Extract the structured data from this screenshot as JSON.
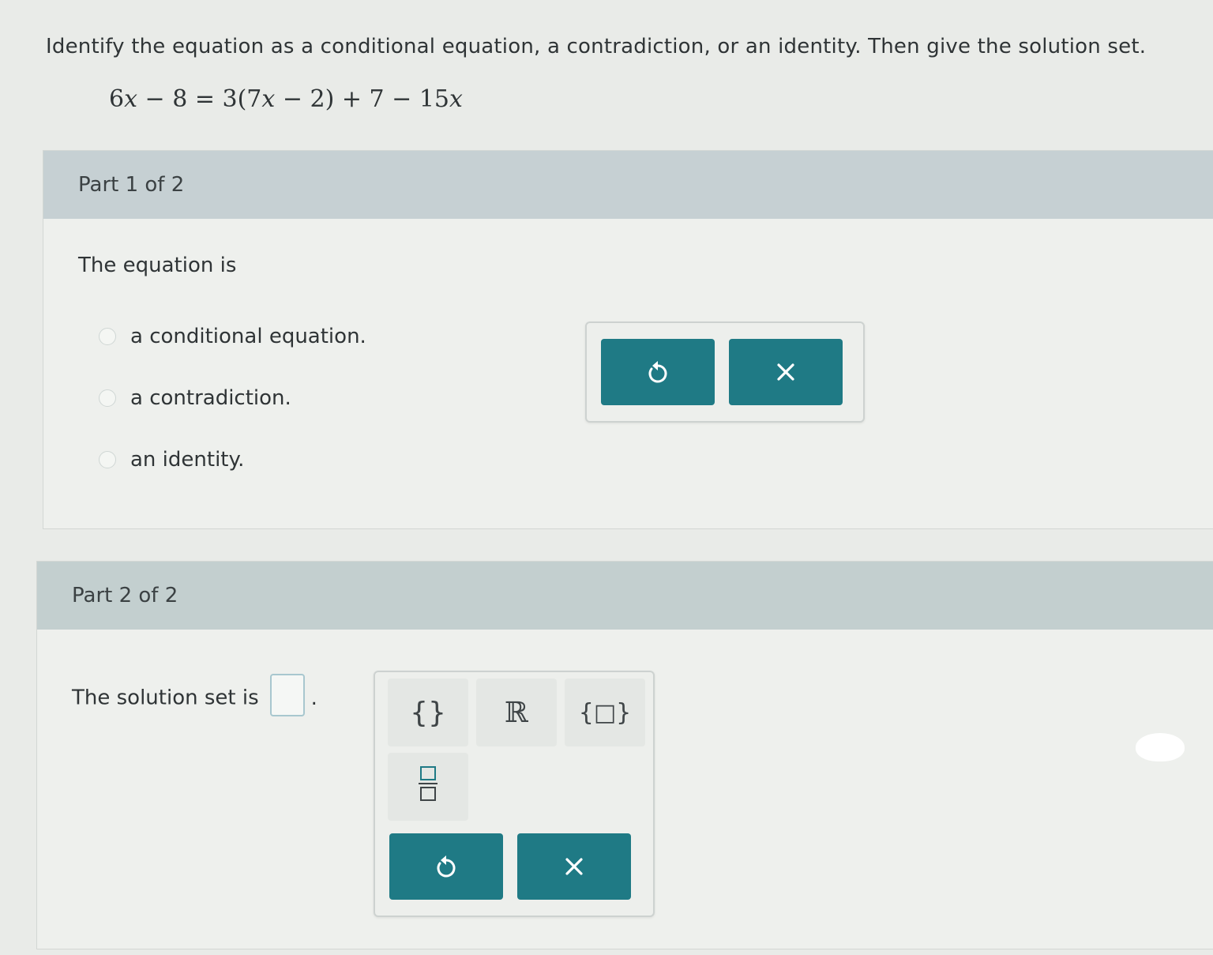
{
  "question": {
    "instruction": "Identify the equation as a conditional equation, a contradiction, or an identity. Then give the solution set.",
    "equation": {
      "c1": "6",
      "v1": "x",
      "p1": " − 8 = 3(7",
      "v2": "x",
      "p2": " − 2) + 7 − 15",
      "v3": "x"
    }
  },
  "part1": {
    "title": "Part 1 of 2",
    "prompt": "The equation is",
    "options": [
      {
        "label": "a conditional equation."
      },
      {
        "label": "a contradiction."
      },
      {
        "label": "an identity."
      }
    ],
    "buttons": {
      "undo_icon": "undo-icon",
      "clear_icon": "close-icon"
    }
  },
  "part2": {
    "title": "Part 2 of 2",
    "prompt": "The solution set is",
    "period": ".",
    "keypad": {
      "empty_set": "{}",
      "reals": "ℝ",
      "set_braces": "{□}",
      "fraction": "fraction-icon"
    },
    "buttons": {
      "undo_icon": "undo-icon",
      "clear_icon": "close-icon"
    }
  },
  "colors": {
    "accent": "#1f7a85",
    "header": "#c6d0d3",
    "background": "#e9ebe8"
  }
}
